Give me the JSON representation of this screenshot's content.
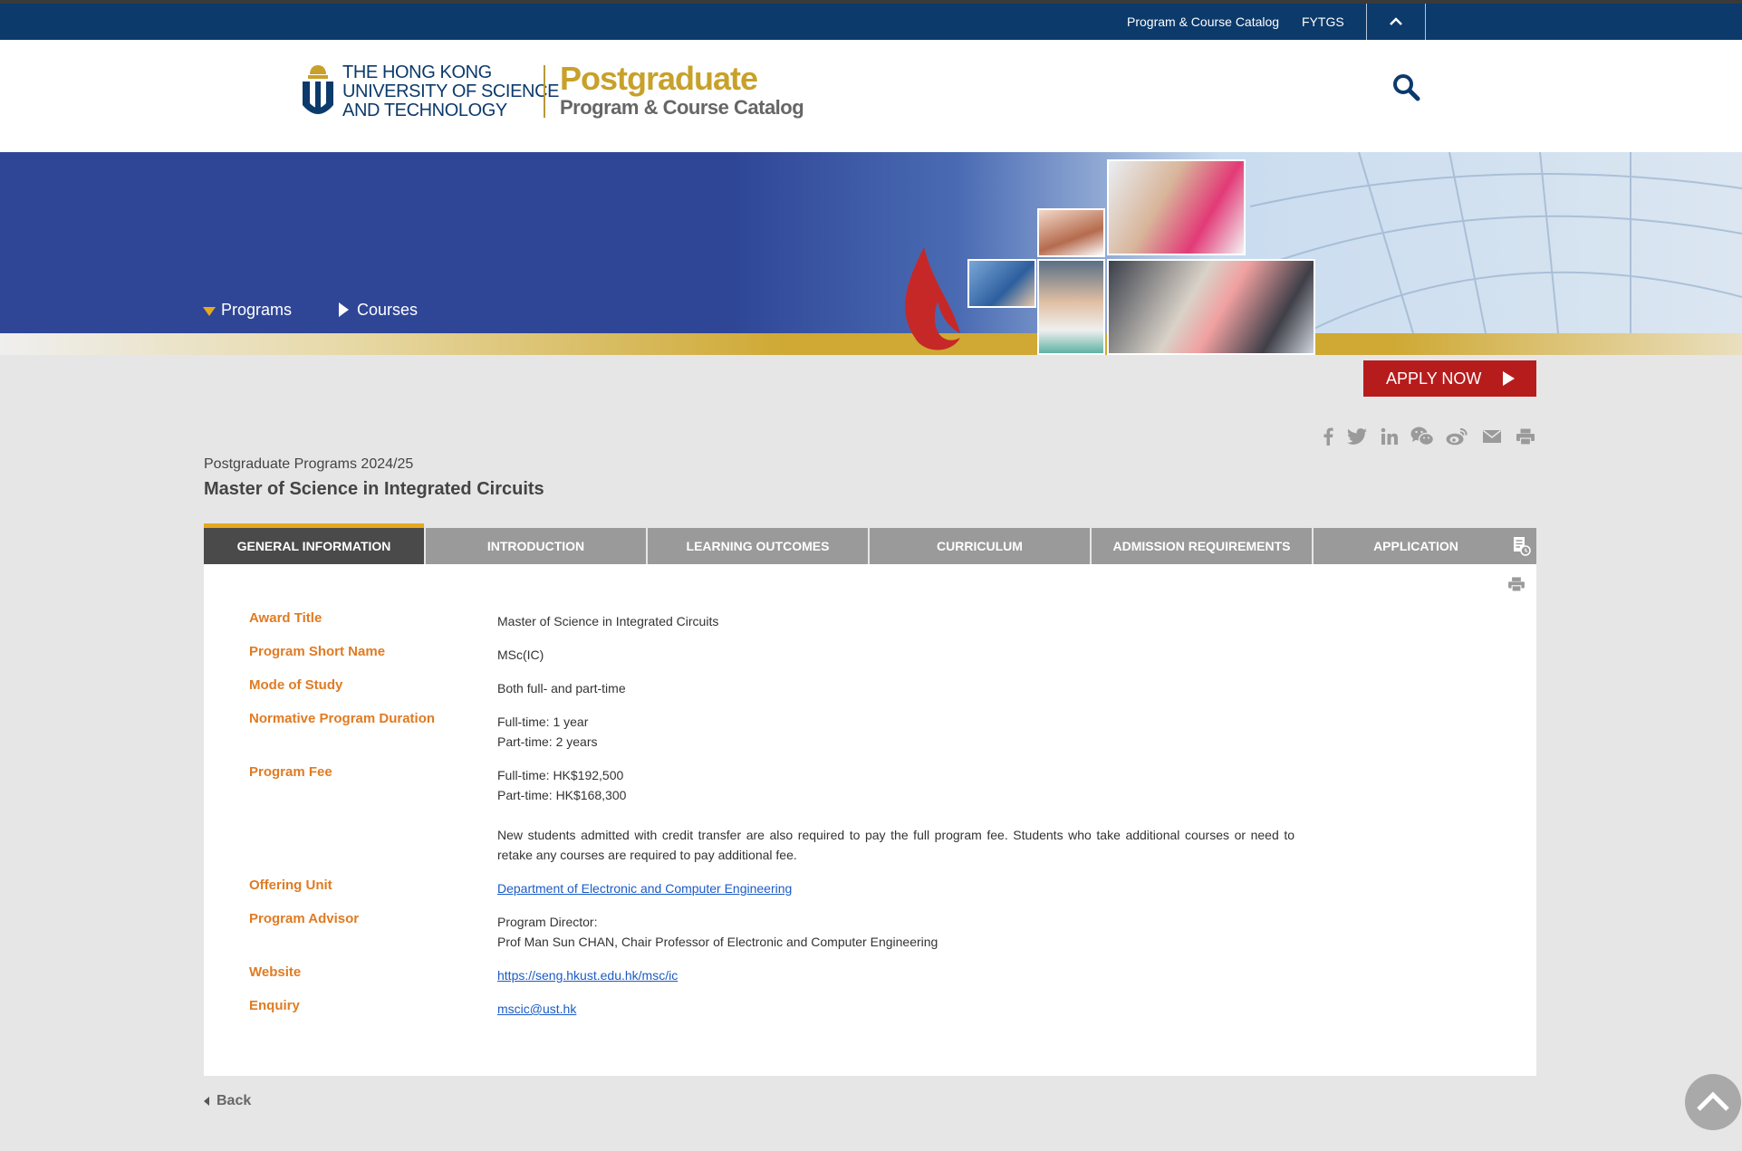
{
  "topbar": {
    "catalog_link": "Program & Course Catalog",
    "fytgs_link": "FYTGS"
  },
  "header": {
    "university_line1": "THE HONG KONG",
    "university_line2": "UNIVERSITY OF SCIENCE",
    "university_line3": "AND TECHNOLOGY",
    "title": "Postgraduate",
    "subtitle": "Program & Course Catalog"
  },
  "nav": {
    "programs": "Programs",
    "courses": "Courses"
  },
  "apply_label": "APPLY NOW",
  "breadcrumb": "Postgraduate Programs 2024/25",
  "program_title": "Master of Science in Integrated Circuits",
  "tabs": [
    {
      "label": "GENERAL INFORMATION",
      "active": true
    },
    {
      "label": "INTRODUCTION"
    },
    {
      "label": "LEARNING OUTCOMES"
    },
    {
      "label": "CURRICULUM"
    },
    {
      "label": "ADMISSION REQUIREMENTS"
    },
    {
      "label": "APPLICATION"
    }
  ],
  "info": {
    "award_title_label": "Award Title",
    "award_title": "Master of Science in Integrated Circuits",
    "short_name_label": "Program Short Name",
    "short_name": "MSc(IC)",
    "mode_label": "Mode of Study",
    "mode": "Both full- and part-time",
    "duration_label": "Normative Program Duration",
    "duration_ft": "Full-time: 1 year",
    "duration_pt": "Part-time: 2 years",
    "fee_label": "Program Fee",
    "fee_ft": "Full-time: HK$192,500",
    "fee_pt": "Part-time: HK$168,300",
    "fee_note": "New students admitted with credit transfer are also required to pay the full program fee. Students who take additional courses or need to retake any courses are required to pay additional fee.",
    "unit_label": "Offering Unit",
    "unit": "Department of Electronic and Computer Engineering",
    "advisor_label": "Program Advisor",
    "advisor_role": "Program Director:",
    "advisor_name": "Prof Man Sun CHAN, Chair Professor of Electronic and Computer Engineering",
    "website_label": "Website",
    "website": "https://seng.hkust.edu.hk/msc/ic",
    "enquiry_label": "Enquiry",
    "enquiry": "mscic@ust.hk"
  },
  "back_label": "Back",
  "icons": [
    "facebook-icon",
    "twitter-icon",
    "linkedin-icon",
    "wechat-icon",
    "weibo-icon",
    "email-icon",
    "print-icon",
    "search-icon",
    "chevron-up-icon"
  ],
  "colors": {
    "navy": "#0c3a6b",
    "gold": "#c8a12a",
    "orange_label": "#e07b22",
    "apply_red": "#b71c1c"
  }
}
